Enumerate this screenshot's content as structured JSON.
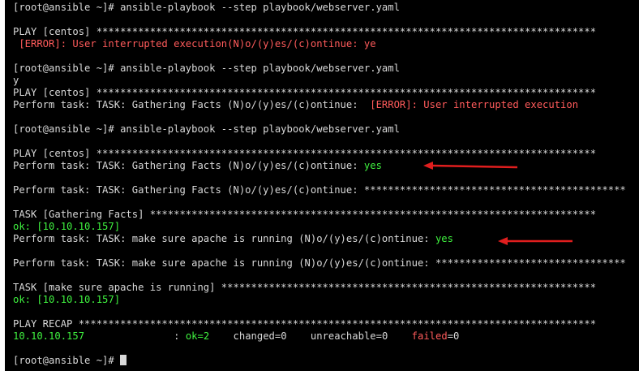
{
  "colors": {
    "background": "#000000",
    "text": "#d8d8d8",
    "error": "#ff5b5b",
    "ok": "#3ff23f",
    "arrow": "#e01e1e"
  },
  "terminal": {
    "l1": "[root@ansible ~]# ansible-playbook --step playbook/webserver.yaml",
    "l3": "PLAY [centos] ************************************************************************************",
    "l4_error": " [ERROR]: User interrupted execution",
    "l4_rest": "(N)o/(y)es/(c)ontinue: ye",
    "l6": "[root@ansible ~]# ansible-playbook --step playbook/webserver.yaml",
    "l7": "y",
    "l8": "PLAY [centos] ************************************************************************************",
    "l9_prefix": "Perform task: TASK: Gathering Facts (N)o/(y)es/(c)ontinue:  ",
    "l9_error": "[ERROR]: User interrupted execution",
    "l11": "[root@ansible ~]# ansible-playbook --step playbook/webserver.yaml",
    "l13": "PLAY [centos] ************************************************************************************",
    "l14_prefix": "Perform task: TASK: Gathering Facts (N)o/(y)es/(c)ontinue: ",
    "l14_yes": "yes",
    "l16": "Perform task: TASK: Gathering Facts (N)o/(y)es/(c)ontinue: ********************************************",
    "l18": "TASK [Gathering Facts] ***************************************************************************",
    "l19": "ok: [10.10.10.157]",
    "l20_prefix": "Perform task: TASK: make sure apache is running (N)o/(y)es/(c)ontinue: ",
    "l20_yes": "yes",
    "l22": "Perform task: TASK: make sure apache is running (N)o/(y)es/(c)ontinue: ********************************",
    "l24": "TASK [make sure apache is running] ***************************************************************",
    "l25": "ok: [10.10.10.157]",
    "l27": "PLAY RECAP ***************************************************************************************",
    "l28_host": "10.10.10.157",
    "l28_sep": "               : ",
    "l28_ok": "ok=2",
    "l28_mid": "    changed=0    unreachable=0    ",
    "l28_failed": "failed",
    "l28_failed_val": "=0",
    "l30_prompt": "[root@ansible ~]# "
  },
  "annotations": {
    "arrow_1": "red-arrow-icon",
    "arrow_2": "red-arrow-icon"
  }
}
